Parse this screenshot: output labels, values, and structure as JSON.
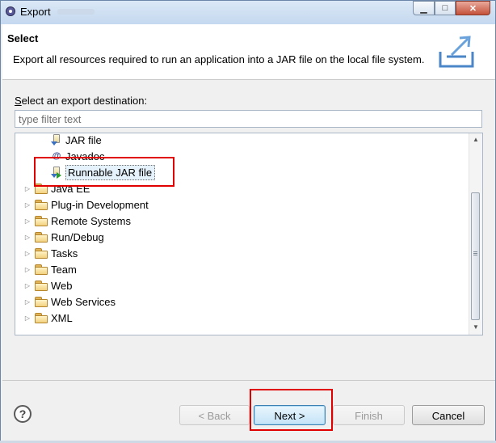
{
  "window": {
    "title": "Export"
  },
  "header": {
    "title": "Select",
    "description": "Export all resources required to run an application into a JAR file on the local file system."
  },
  "destination": {
    "label_prefix": "",
    "label_accel": "S",
    "label_rest": "elect an export destination:",
    "filter_placeholder": "type filter text"
  },
  "tree": {
    "children": [
      {
        "label": "JAR file",
        "icon": "jar-icon"
      },
      {
        "label": "Javadoc",
        "icon": "javadoc-icon"
      },
      {
        "label": "Runnable JAR file",
        "icon": "runnable-jar-icon",
        "selected": true
      }
    ],
    "categories": [
      {
        "label": "Java EE"
      },
      {
        "label": "Plug-in Development"
      },
      {
        "label": "Remote Systems"
      },
      {
        "label": "Run/Debug"
      },
      {
        "label": "Tasks"
      },
      {
        "label": "Team"
      },
      {
        "label": "Web"
      },
      {
        "label": "Web Services"
      },
      {
        "label": "XML"
      }
    ]
  },
  "buttons": {
    "help": "?",
    "back": "< Back",
    "next": "Next >",
    "finish": "Finish",
    "cancel": "Cancel"
  },
  "colors": {
    "highlight_box": "#e00000",
    "selection": "#e5f1fb"
  }
}
